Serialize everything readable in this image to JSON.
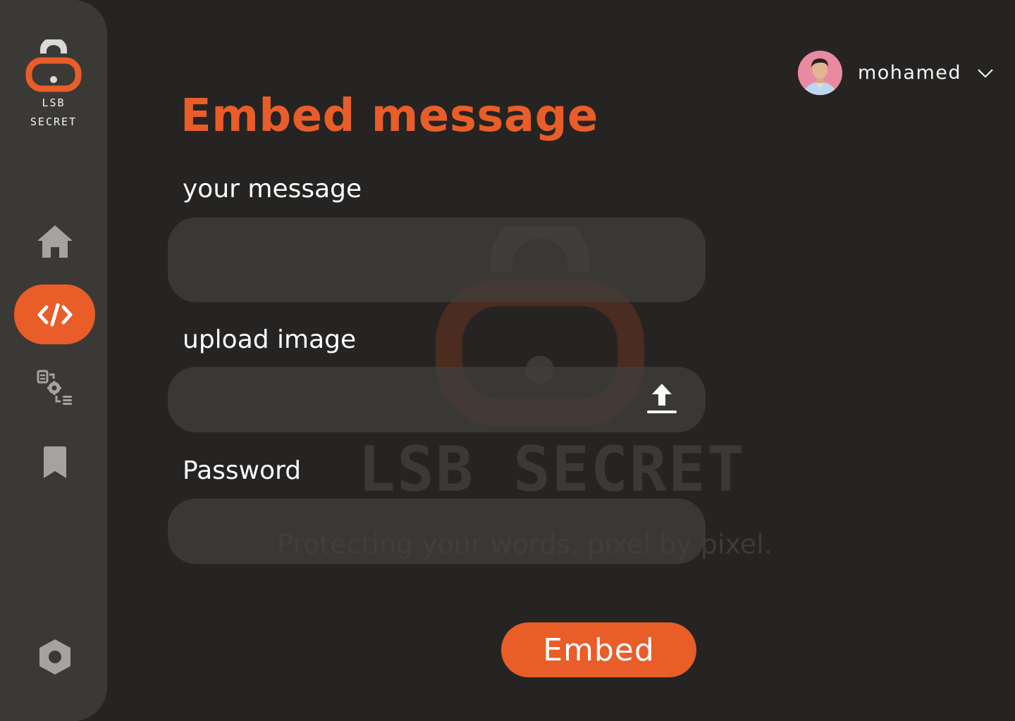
{
  "brand": {
    "name_line1": "LSB",
    "name_line2": "SECRET",
    "accent_color": "#e95d28",
    "logo_icon": "padlock-icon"
  },
  "sidebar": {
    "items": [
      {
        "icon": "home-icon",
        "active": false
      },
      {
        "icon": "code-icon",
        "active": true
      },
      {
        "icon": "data-settings-icon",
        "active": false
      },
      {
        "icon": "bookmark-icon",
        "active": false
      }
    ],
    "bottom_icon": "hexagon-settings-icon"
  },
  "header": {
    "user_name": "mohamed",
    "avatar_icon": "user-avatar",
    "dropdown_icon": "chevron-down-icon"
  },
  "page": {
    "title": "Embed message"
  },
  "form": {
    "message_label": "your message",
    "message_value": "",
    "upload_label": "upload image",
    "upload_icon": "upload-icon",
    "password_label": "Password",
    "password_value": "",
    "submit_label": "Embed"
  },
  "watermark": {
    "title": "LSB SECRET",
    "tagline": "Protecting your words, pixel by pixel."
  },
  "colors": {
    "background": "#252423",
    "sidebar": "#3b3936",
    "accent": "#e95d28",
    "field": "#42403d"
  }
}
